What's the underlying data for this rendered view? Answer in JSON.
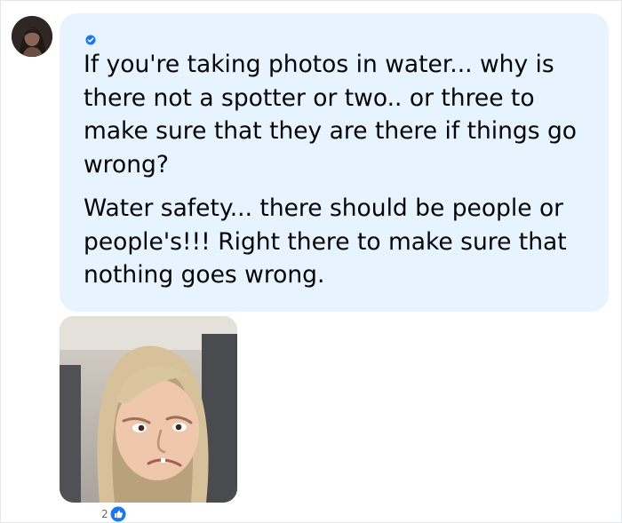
{
  "comment": {
    "author_avatar": "profile-photo",
    "badge": "verified-check-icon",
    "paragraphs": [
      "If you're taking photos in water... why is there not a spotter or two.. or three to make sure that they are there if things go wrong?",
      "Water safety... there should be people or people's!!! Right there to make sure that nothing goes wrong."
    ],
    "attachment": "side-eyeing-child-reaction-image"
  },
  "reactions": {
    "count": "2",
    "icon": "like-icon"
  },
  "colors": {
    "bubble_background": "#e7f3ff",
    "text": "#050505",
    "like_blue": "#1877f2",
    "count_gray": "#65676b"
  }
}
